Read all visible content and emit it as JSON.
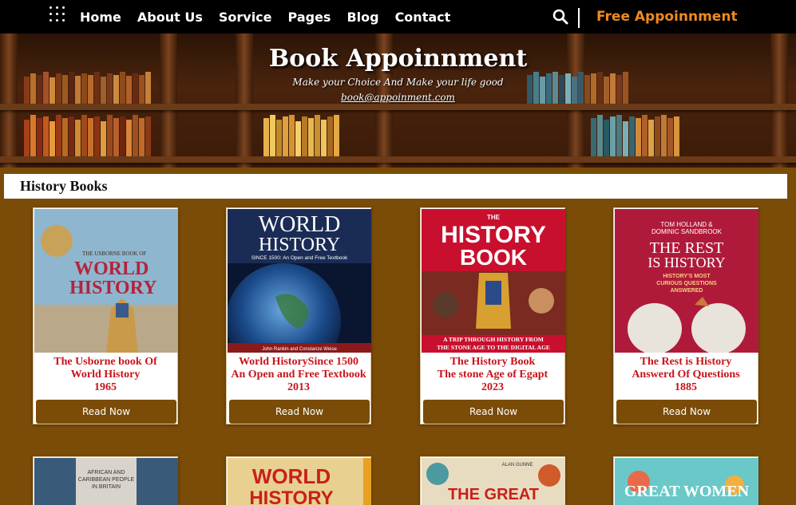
{
  "nav": {
    "links": [
      "Home",
      "About Us",
      "Sorvice",
      "Pages",
      "Blog",
      "Contact"
    ],
    "cta": "Free Appoinnment",
    "cta_color": "#ef8a1e"
  },
  "hero": {
    "title": "Book Appoinnment",
    "subtitle": "Make your Choice And Make your life good",
    "email": "book@appoinment.com"
  },
  "section": {
    "title": "History Books"
  },
  "books": [
    {
      "line1": "The Usborne book Of",
      "line2": "World History",
      "line3": "1965",
      "button": "Read Now"
    },
    {
      "line1": "World HistorySince 1500",
      "line2": "An Open and Free Textbook",
      "line3": "2013",
      "button": "Read Now"
    },
    {
      "line1": "The History Book",
      "line2": "The stone Age of Egapt",
      "line3": "2023",
      "button": "Read Now"
    },
    {
      "line1": "The Rest is History",
      "line2": "Answerd Of Questions",
      "line3": "1885",
      "button": "Read Now"
    }
  ],
  "covers": {
    "c1": {
      "small": "THE USBORNE BOOK OF",
      "big1": "WORLD",
      "big2": "HISTORY"
    },
    "c2": {
      "big1": "WORLD",
      "big2": "HISTORY",
      "sub": "SINCE 1500: An Open and Free Textbook",
      "authors": "John Rankin and Constanze Weise"
    },
    "c3": {
      "small": "THE",
      "big1": "HISTORY",
      "big2": "BOOK",
      "tag1": "A TRIP THROUGH HISTORY FROM",
      "tag2": "THE STONE AGE TO THE DIGITAL AGE"
    },
    "c4": {
      "authors1": "TOM HOLLAND &",
      "authors2": "DOMINIC SANDBROOK",
      "big1": "THE REST",
      "big2": "IS HISTORY",
      "sub1": "HISTORY'S MOST",
      "sub2": "CURIOUS QUESTIONS",
      "sub3": "ANSWERED"
    },
    "c5": {
      "text1": "AFRICAN AND",
      "text2": "CARIBBEAN PEOPLE",
      "text3": "IN BRITAIN"
    },
    "c6": {
      "big1": "WORLD",
      "big2": "HISTORY"
    },
    "c7": {
      "author": "ALAN GUNNE",
      "big": "THE GREAT"
    },
    "c8": {
      "big": "GREAT WOMEN"
    }
  }
}
